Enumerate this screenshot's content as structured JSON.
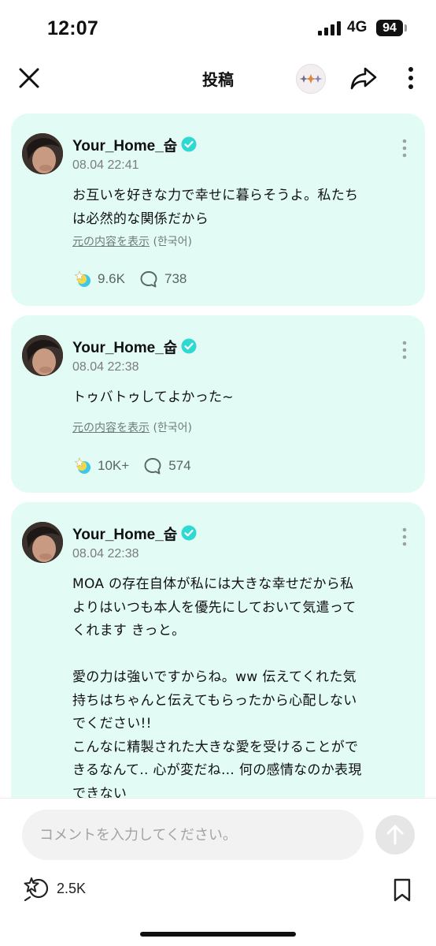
{
  "status_bar": {
    "time": "12:07",
    "network": "4G",
    "battery": "94"
  },
  "nav": {
    "title": "投稿",
    "close_icon": "close-icon",
    "share_icon": "share-icon",
    "more_icon": "more-vertical-icon"
  },
  "posts": [
    {
      "author": "Your_Home_숩",
      "time": "08.04 22:41",
      "text": "お互いを好きな力で幸せに暮らそうよ。私たち\nは必然的な関係だから",
      "translate_label": "元の内容を表示",
      "translate_lang": "(한국어)",
      "likes": "9.6K",
      "comments": "738"
    },
    {
      "author": "Your_Home_숩",
      "time": "08.04 22:38",
      "text": "トゥバトゥしてよかった~",
      "translate_label": "元の内容を表示",
      "translate_lang": "(한국어)",
      "likes": "10K+",
      "comments": "574"
    },
    {
      "author": "Your_Home_숩",
      "time": "08.04 22:38",
      "text": "MOA の存在自体が私には大きな幸せだから私\nよりはいつも本人を優先にしておいて気遣って\nくれます きっと。\n\n愛の力は強いですからね。ww 伝えてくれた気\n持ちはちゃんと伝えてもらったから心配しない\nでください!!\nこんなに精製された大きな愛を受けることがで\nきるなんて.. 心が変だね… 何の感情なのか表現\nできない"
    }
  ],
  "comment_box": {
    "placeholder": "コメントを入力してください。"
  },
  "footer": {
    "like_count": "2.5K"
  },
  "colors": {
    "card_background": "#e2fbf5",
    "verified": "#2fd8d0",
    "accent": "#25c7c1"
  }
}
